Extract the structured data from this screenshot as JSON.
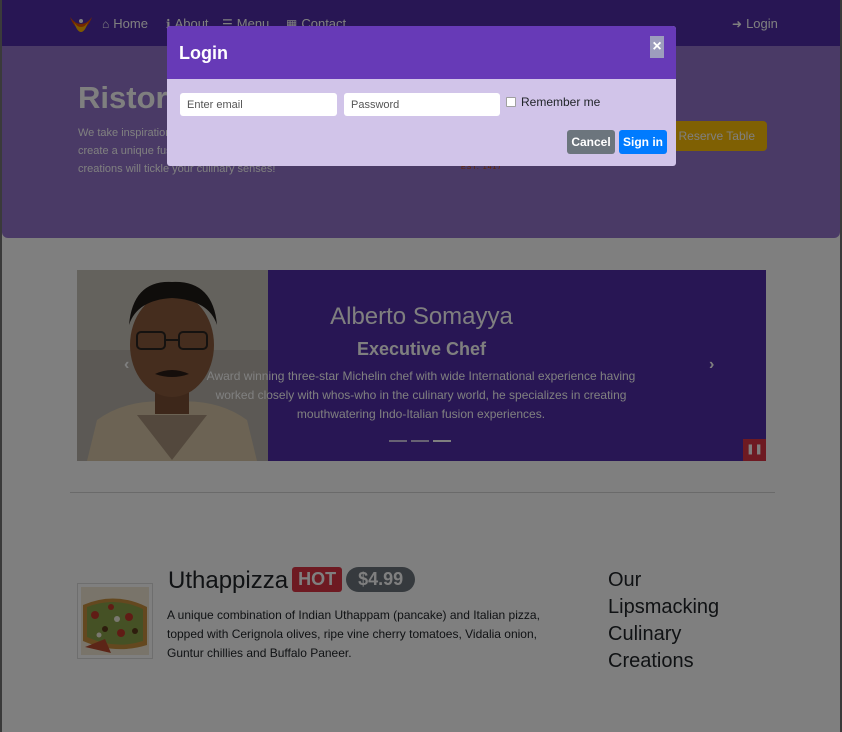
{
  "navbar": {
    "home_label": "Home",
    "about_label": "About",
    "menu_label": "Menu",
    "contact_label": "Contact",
    "login_label": "Login"
  },
  "jumbotron": {
    "title": "Ristorante con Fusion",
    "text": "We take inspiration from the World's best cuisines, and create a unique fusion experience. Our lipsmacking creations will tickle your culinary senses!",
    "reserve_label": "Reserve Table",
    "est_label": "EST. 1417"
  },
  "carousel": {
    "name": "Alberto Somayya",
    "role": "Executive Chef",
    "description": "Award winning three-star Michelin chef with wide International experience having worked closely with whos-who in the culinary world, he specializes in creating mouthwatering Indo-Italian fusion experiences.",
    "indicator_count": 3,
    "active_indicator": 2
  },
  "dish": {
    "name": "Uthappizza",
    "badge": "HOT",
    "price": "$4.99",
    "description": "A unique combination of Indian Uthappam (pancake) and Italian pizza, topped with Cerignola olives, ripe vine cherry tomatoes, Vidalia onion, Guntur chillies and Buffalo Paneer."
  },
  "side_heading": "Our Lipsmacking Culinary Creations",
  "modal": {
    "title": "Login",
    "close_symbol": "×",
    "email_placeholder": "Enter email",
    "password_placeholder": "Password",
    "remember_label": "Remember me",
    "cancel_label": "Cancel",
    "signin_label": "Sign in"
  },
  "colors": {
    "primary_dark": "#512da8",
    "primary": "#673ab7",
    "primary_light": "#9575cd",
    "modal_body": "#d1c4e9",
    "warning": "#ffc107",
    "danger": "#dc3545",
    "secondary": "#6c757d",
    "blue": "#007bff"
  },
  "icons": [
    "logo-icon",
    "home-icon",
    "info-icon",
    "list-icon",
    "address-card-icon",
    "sign-in-icon",
    "chevron-left-icon",
    "chevron-right-icon",
    "pause-icon",
    "close-icon"
  ]
}
